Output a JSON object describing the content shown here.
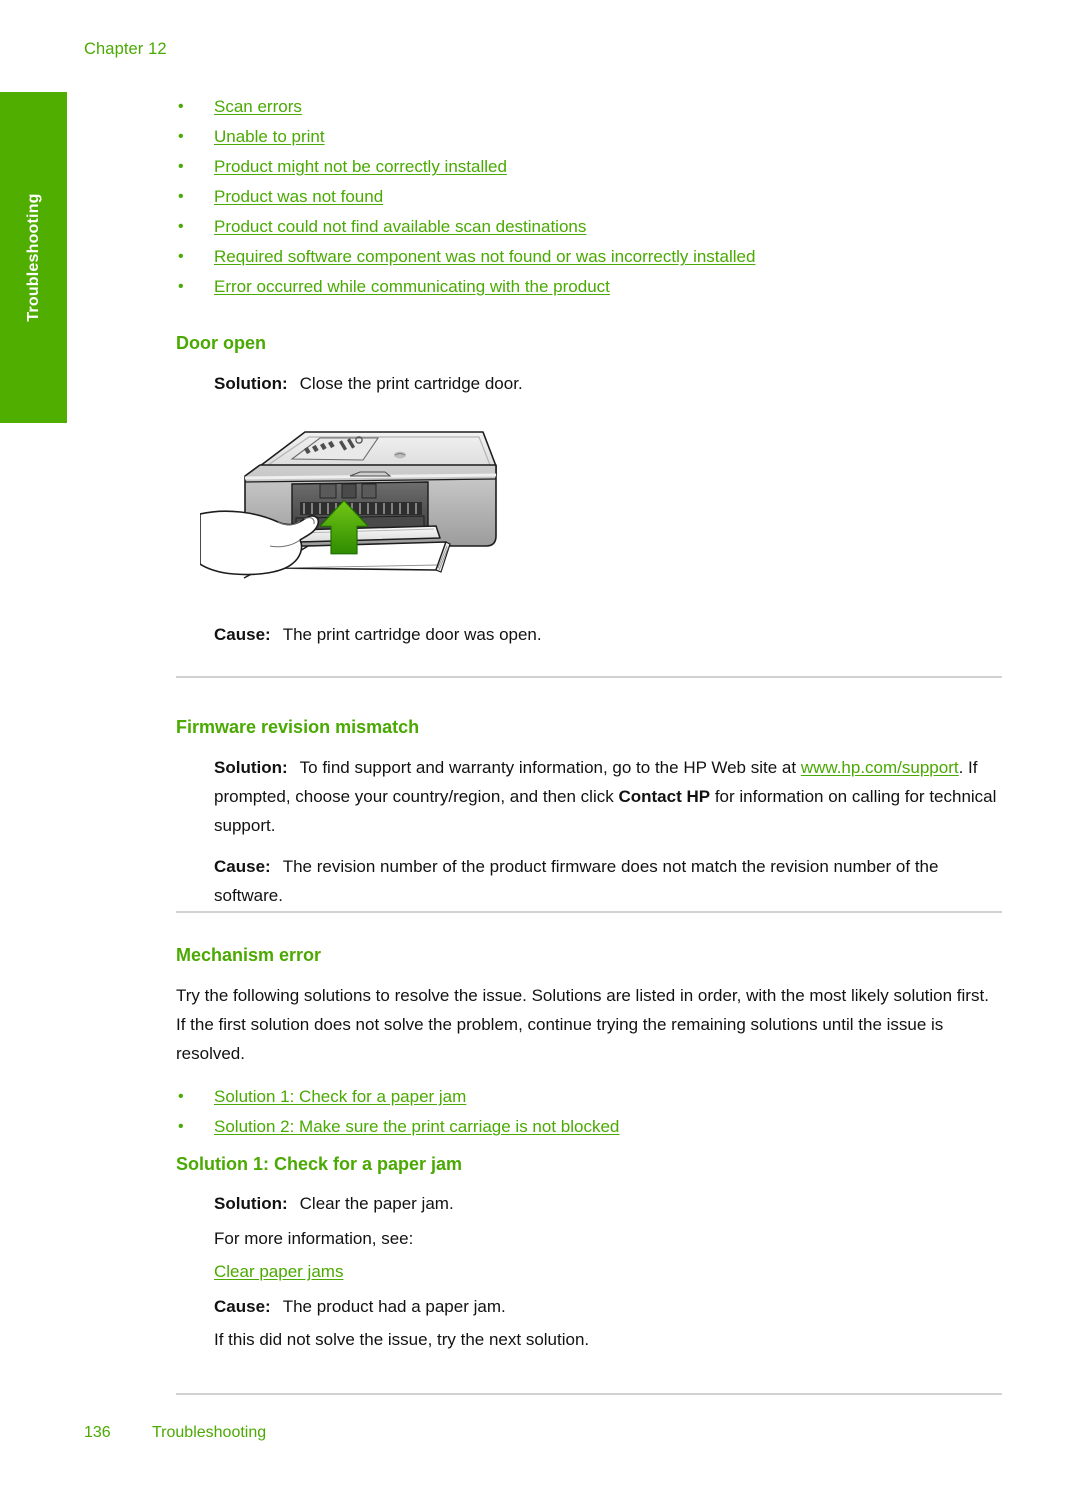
{
  "chapter": {
    "label": "Chapter 12"
  },
  "side_tab": {
    "label": "Troubleshooting"
  },
  "top_links": [
    {
      "label": "Scan errors"
    },
    {
      "label": "Unable to print"
    },
    {
      "label": "Product might not be correctly installed"
    },
    {
      "label": "Product was not found"
    },
    {
      "label": "Product could not find available scan destinations"
    },
    {
      "label": "Required software component was not found or was incorrectly installed"
    },
    {
      "label": "Error occurred while communicating with the product"
    }
  ],
  "door_open": {
    "heading": "Door open",
    "solution_label": "Solution:",
    "solution_text": "Close the print cartridge door.",
    "cause_label": "Cause:",
    "cause_text": "The print cartridge door was open.",
    "figure_alt": "all-in-one printer with hand closing the print cartridge door"
  },
  "firmware": {
    "heading": "Firmware revision mismatch",
    "solution_label": "Solution:",
    "solution_text_1": "To find support and warranty information, go to the HP Web site at",
    "solution_link": "www.hp.com/support",
    "solution_text_2": ". If prompted, choose your country/region, and then click",
    "solution_bold": "Contact HP",
    "solution_text_3": "for information on calling for technical support.",
    "cause_label": "Cause:",
    "cause_text": "The revision number of the product firmware does not match the revision number of the software."
  },
  "mechanism": {
    "heading": "Mechanism error",
    "intro": "Try the following solutions to resolve the issue. Solutions are listed in order, with the most likely solution first. If the first solution does not solve the problem, continue trying the remaining solutions until the issue is resolved.",
    "links": [
      {
        "label": "Solution 1: Check for a paper jam"
      },
      {
        "label": "Solution 2: Make sure the print carriage is not blocked"
      }
    ]
  },
  "solution1": {
    "heading": "Solution 1: Check for a paper jam",
    "solution_label": "Solution:",
    "solution_text": "Clear the paper jam.",
    "more_info": "For more information, see:",
    "link": "Clear paper jams",
    "cause_label": "Cause:",
    "cause_text": "The product had a paper jam.",
    "next": "If this did not solve the issue, try the next solution."
  },
  "footer": {
    "page_number": "136",
    "section": "Troubleshooting"
  },
  "colors": {
    "accent_green": "#4aa902",
    "tab_green": "#4fae00",
    "rule_gray": "#d2d2d2",
    "body_text": "#121212"
  }
}
